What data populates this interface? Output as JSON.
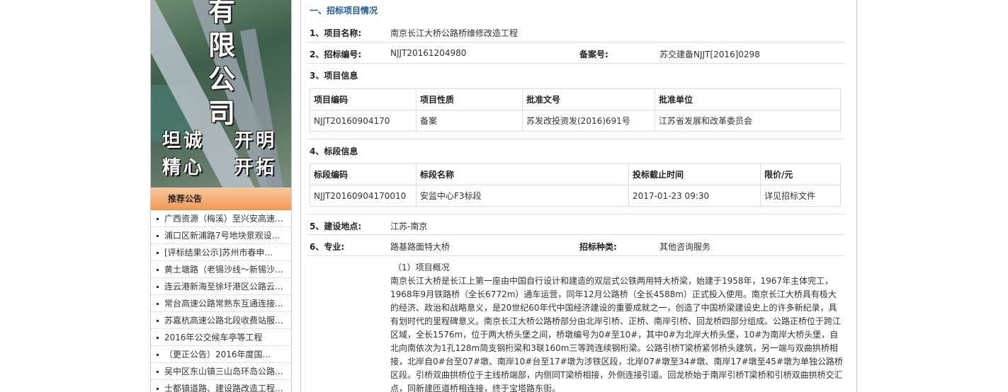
{
  "sidebar": {
    "banner": {
      "title_chars": [
        "有",
        "限",
        "公",
        "司"
      ],
      "slogan": [
        "坦诚",
        "开明",
        "精心",
        "开拓"
      ]
    },
    "recommend_header": "推荐公告",
    "recommend_items": [
      "广西资源（梅溪）至兴安高速...",
      "浦口区新浦路7号地块景观设...",
      "[评标结果公示]苏州市春申...",
      "黄土塘路（老锡沙线～新锡沙...",
      "连云港新海至徐圩港区公路云...",
      "常台高速公路常熟东互通连接...",
      "苏嘉杭高速公路北段收费站服...",
      "2016年公交候车亭等工程",
      "（更正公告）2016年度国...",
      "吴中区东山镇三山岛环岛公路...",
      "士都镇道路、建设路改造工程..."
    ]
  },
  "main": {
    "section_title": "一、招标项目情况",
    "project_name_label": "1、项目名称:",
    "project_name": "南京长江大桥公路桥维修改造工程",
    "bid_no_label": "2、招标编号:",
    "bid_no": "NJJT20161204980",
    "record_no_label": "备案号:",
    "record_no": "苏交建备NJJT[2016]0298",
    "project_info_label": "3、项目信息",
    "project_table": {
      "headers": [
        "项目编码",
        "项目性质",
        "批准文号",
        "批准单位"
      ],
      "row": [
        "NJJT20160904170",
        "备案",
        "苏发改投资发(2016)691号",
        "江苏省发展和改革委员会"
      ]
    },
    "section_info_label": "4、标段信息",
    "section_table": {
      "headers": [
        "标段编码",
        "标段名称",
        "投标截止时间",
        "限价/元"
      ],
      "row": [
        "NJJT20160904170010",
        "安监中心F3标段",
        "2017-01-23 09:30",
        "详见招标文件"
      ]
    },
    "location_label": "5、建设地点:",
    "location": "江苏-南京",
    "major_label": "6、专业:",
    "major": "路基路面特大桥",
    "tender_type_label": "招标种类:",
    "tender_type": "其他咨询服务",
    "overview_heading": "（1）项目概况",
    "overview_text": "南京长江大桥是长江上第一座由中国自行设计和建造的双层式公铁两用特大桥梁，始建于1958年，1967年主体完工，1968年9月铁路桥（全长6772m）通车运营，同年12月公路桥（全长4588m）正式投入使用。南京长江大桥具有极大的经济、政治和战略意义，是20世纪60年代中国经济建设的重要成就之一，创造了中国桥梁建设史上的许多新纪录，具有划时代的里程碑意义。南京长江大桥公路桥部分由北岸引桥、正桥、南岸引桥、回龙桥四部分组成。公路正桥位于跨江区域，全长1576m，位于两大桥头堡之间，桥墩编号为0#至10#，其中0#为北岸大桥头堡，10#为南岸大桥头堡，自北向南依次为1孔128m简支钢桁梁和3联160m三等跨连续钢桁梁。公路引桥T梁桥紧邻桥头建筑，另一端与双曲拱桥相接，北岸自0#台至07#墩、南岸10#台至17#墩为涉铁区段，北岸07#墩至34#墩、南岸17#墩至45#墩为单独公路桥区段。引桥双曲拱桥位于主线桥端部，内侧同T梁桥相接，外侧连接引道。回龙桥始于南岸引桥T梁桥和引桥双曲拱桥交汇点，同新建匝道桥相连接，终于宝塔路东街。"
  }
}
